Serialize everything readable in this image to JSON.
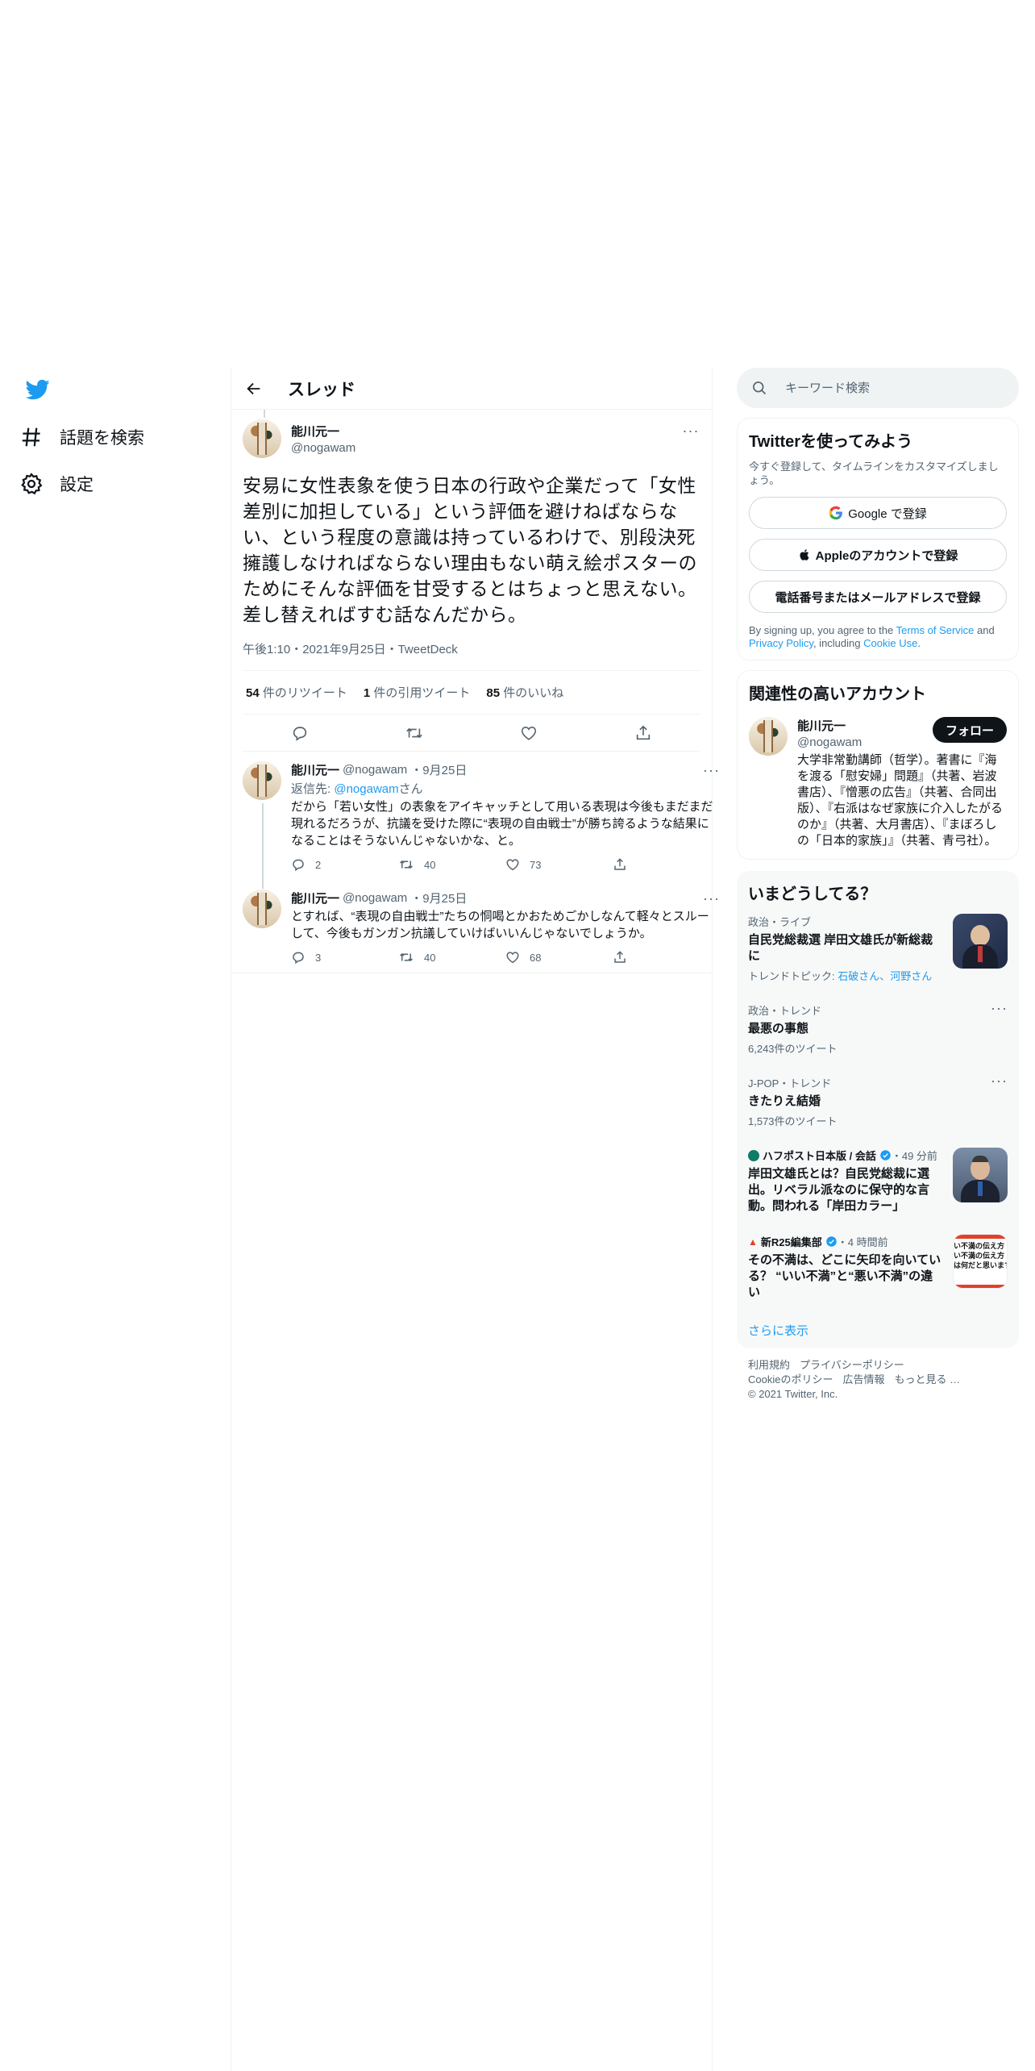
{
  "nav": {
    "logo": "twitter-bird",
    "items": [
      {
        "label": "話題を検索",
        "icon": "hashtag-icon"
      },
      {
        "label": "設定",
        "icon": "gear-icon"
      }
    ]
  },
  "header": {
    "title": "スレッド"
  },
  "focal_tweet": {
    "name": "能川元一",
    "handle": "@nogawam",
    "text": "安易に女性表象を使う日本の行政や企業だって「女性差別に加担している」という評価を避けねばならない、という程度の意識は持っているわけで、別段決死擁護しなければならない理由もない萌え絵ポスターのためにそんな評価を甘受するとはちょっと思えない。差し替えればすむ話なんだから。",
    "meta": "午後1:10・2021年9月25日・TweetDeck",
    "retweets_count": "54",
    "retweets_label": "件のリツイート",
    "quotes_count": "1",
    "quotes_label": "件の引用ツイート",
    "likes_count": "85",
    "likes_label": "件のいいね"
  },
  "replies": [
    {
      "name": "能川元一",
      "handle": "@nogawam",
      "date": "・9月25日",
      "reply_to_prefix": "返信先: ",
      "reply_to_handle": "@nogawam",
      "reply_to_suffix": "さん",
      "text": "だから「若い女性」の表象をアイキャッチとして用いる表現は今後もまだまだ現れるだろうが、抗議を受けた際に“表現の自由戦士”が勝ち誇るような結果になることはそうないんじゃないかな、と。",
      "replies": "2",
      "retweets": "40",
      "likes": "73"
    },
    {
      "name": "能川元一",
      "handle": "@nogawam",
      "date": "・9月25日",
      "text": "とすれば、“表現の自由戦士”たちの恫喝とかおためごかしなんて軽々とスルーして、今後もガンガン抗議していけばいいんじゃないでしょうか。",
      "replies": "3",
      "retweets": "40",
      "likes": "68"
    }
  ],
  "search": {
    "placeholder": "キーワード検索"
  },
  "signup": {
    "title": "Twitterを使ってみよう",
    "subtitle": "今すぐ登録して、タイムラインをカスタマイズしましょう。",
    "google_label": "Google で登録",
    "apple_label": "Appleのアカウントで登録",
    "phone_label": "電話番号またはメールアドレスで登録",
    "terms_prefix": "By signing up, you agree to the ",
    "terms_link": "Terms of Service",
    "terms_and": " and ",
    "privacy_link": "Privacy Policy",
    "terms_including": ", including ",
    "cookie_link": "Cookie Use",
    "terms_end": "."
  },
  "relevant": {
    "title": "関連性の高いアカウント",
    "name": "能川元一",
    "handle": "@nogawam",
    "follow_label": "フォロー",
    "bio": "大学非常勤講師（哲学）。著書に『海を渡る「慰安婦」問題』（共著、岩波書店）、『憎悪の広告』（共著、合同出版）、『右派はなぜ家族に介入したがるのか』（共著、大月書店）、『まぼろしの「日本的家族」』（共著、青弓社）。"
  },
  "trends": {
    "title": "いまどうしてる？",
    "items": [
      {
        "context": "政治・ライブ",
        "name": "自民党総裁選 岸田文雄氏が新総裁に",
        "sub_prefix": "トレンドトピック: ",
        "sub_links": "石破さん、河野さん",
        "has_image": true
      },
      {
        "context": "政治・トレンド",
        "name": "最悪の事態",
        "count": "6,243件のツイート"
      },
      {
        "context": "J-POP・トレンド",
        "name": "きたりえ結婚",
        "count": "1,573件のツイート"
      }
    ],
    "news": [
      {
        "source": "ハフポスト日本版 / 会話",
        "time": "・49 分前",
        "headline": "岸田文雄氏とは？自民党総裁に選出。リベラル派なのに保守的な言動。問われる「岸田カラー」"
      },
      {
        "source": "新R25編集部",
        "time": "・4 時間前",
        "headline": "その不満は、どこに矢印を向いている？ “いい不満”と“悪い不満”の違い",
        "thumb_text": "い不満の伝え方\nい不満の伝え方\nは何だと思います"
      }
    ],
    "show_more": "さらに表示"
  },
  "footer": {
    "links": [
      "利用規約",
      "プライバシーポリシー",
      "Cookieのポリシー",
      "広告情報",
      "もっと見る …"
    ],
    "copyright": "© 2021 Twitter, Inc."
  },
  "colors": {
    "accent": "#1d9bf0",
    "text": "#0f1419",
    "muted": "#536471",
    "border": "#eff3f4"
  }
}
